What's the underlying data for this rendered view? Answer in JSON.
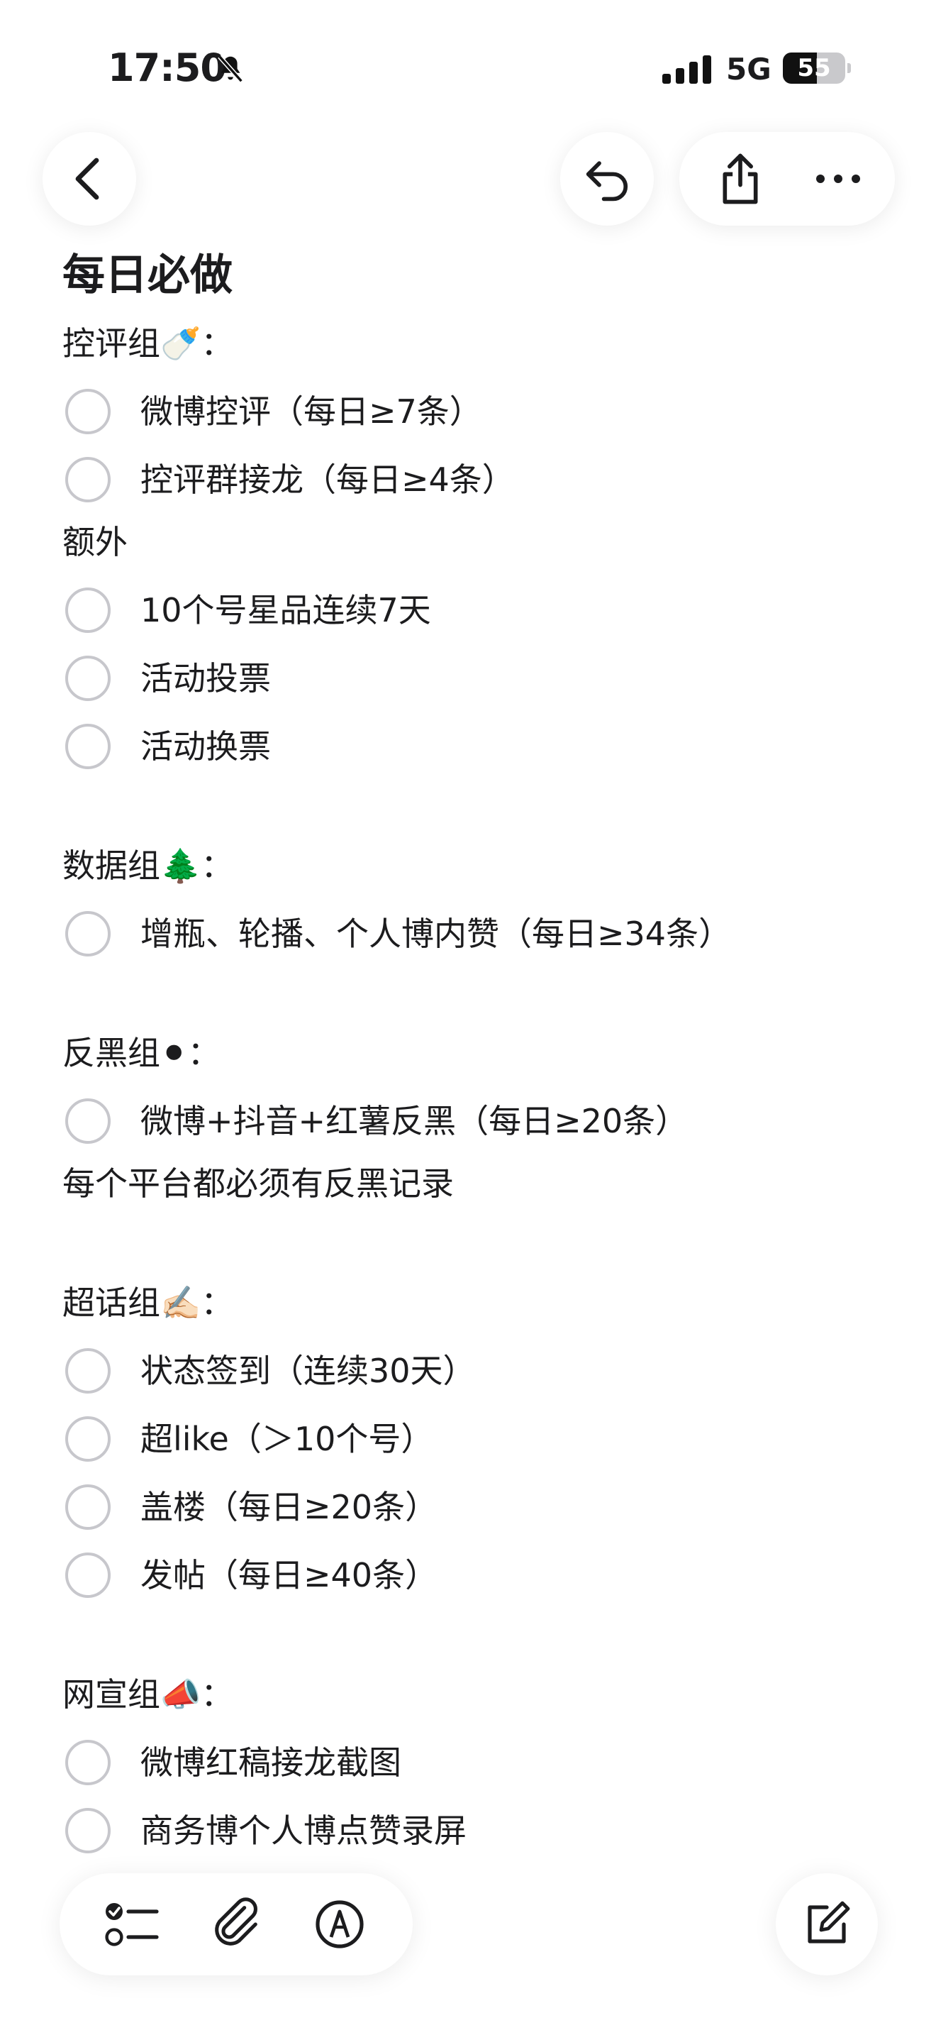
{
  "status_bar": {
    "time": "17:50",
    "network": "5G",
    "battery": "55",
    "battery_level": 0.55
  },
  "note": {
    "title": "每日必做",
    "sections": [
      {
        "label": "控评组🍼：",
        "items": [
          "微博控评（每日≥7条）",
          "控评群接龙（每日≥4条）"
        ]
      },
      {
        "label": "额外",
        "items": [
          "10个号星品连续7天",
          "活动投票",
          "活动换票"
        ]
      },
      {
        "label": "数据组🌲：",
        "items": [
          "增瓶、轮播、个人博内赞（每日≥34条）"
        ]
      },
      {
        "label": "反黑组⚫：",
        "items": [
          "微博+抖音+红薯反黑（每日≥20条）"
        ],
        "after": "每个平台都必须有反黑记录"
      },
      {
        "label": "超话组✍🏻：",
        "items": [
          "状态签到（连续30天）",
          "超like（＞10个号）",
          "盖楼（每日≥20条）",
          "发帖（每日≥40条）"
        ]
      },
      {
        "label": "网宣组📣：",
        "items": [
          "微博红稿接龙截图",
          "商务博个人博点赞录屏"
        ]
      }
    ]
  },
  "icons": {
    "back": "chevron-left-icon",
    "undo": "undo-icon",
    "share": "share-icon",
    "more": "more-icon",
    "checklist": "checklist-icon",
    "attach": "paperclip-icon",
    "markup": "markup-pen-icon",
    "compose": "compose-icon",
    "mute": "bell-slash-icon",
    "signal": "signal-icon"
  }
}
